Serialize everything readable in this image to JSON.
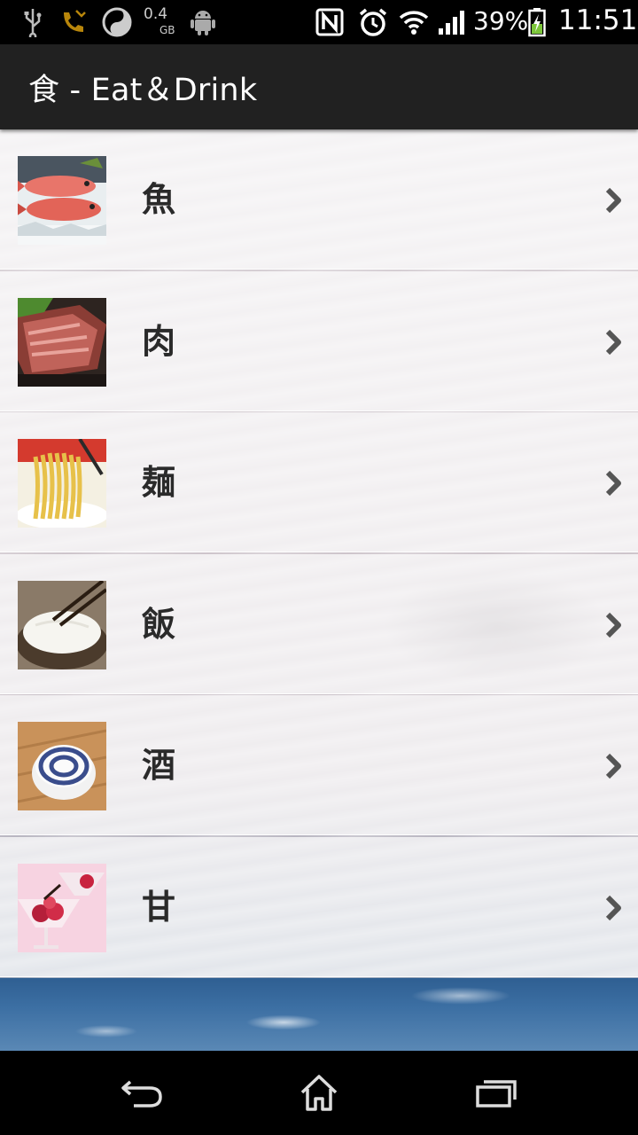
{
  "status_bar": {
    "data_usage_value": "0.4",
    "data_usage_unit": "GB",
    "battery_percent": "39%",
    "time": "11:51",
    "icons": [
      "usb-icon",
      "missed-call-icon",
      "data-saver-icon",
      "android-icon",
      "nfc-icon",
      "alarm-icon",
      "wifi-icon",
      "signal-icon",
      "battery-icon"
    ]
  },
  "action_bar": {
    "title": "食 - Eat＆Drink"
  },
  "list": {
    "items": [
      {
        "label": "魚",
        "image": "fish-image"
      },
      {
        "label": "肉",
        "image": "meat-image"
      },
      {
        "label": "麺",
        "image": "noodles-image"
      },
      {
        "label": "飯",
        "image": "rice-image"
      },
      {
        "label": "酒",
        "image": "sake-image"
      },
      {
        "label": "甘",
        "image": "dessert-image"
      }
    ]
  },
  "nav_bar": {
    "icons": [
      "back-icon",
      "home-icon",
      "recent-apps-icon"
    ]
  },
  "colors": {
    "status_bar_bg": "#000000",
    "action_bar_bg": "#212121",
    "battery_charge": "#7cc63a",
    "list_label": "#2a2a2a"
  }
}
